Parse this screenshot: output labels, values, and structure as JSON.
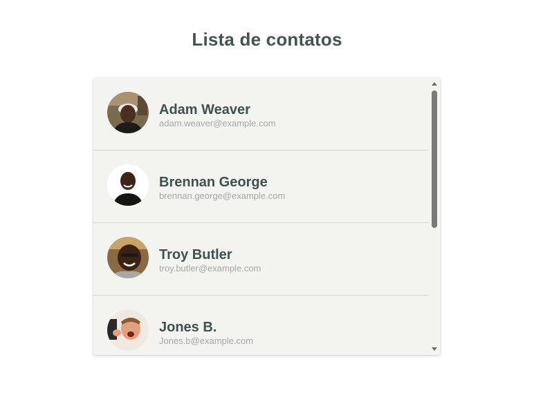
{
  "page": {
    "title": "Lista de contatos"
  },
  "contacts": [
    {
      "name": "Adam Weaver",
      "email": "adam.weaver@example.com",
      "avatar": "avatar-photo"
    },
    {
      "name": "Brennan George",
      "email": "brennan.george@example.com",
      "avatar": "avatar-photo"
    },
    {
      "name": "Troy Butler",
      "email": "troy.butler@example.com",
      "avatar": "avatar-photo"
    },
    {
      "name": "Jones B.",
      "email": "Jones.b@example.com",
      "avatar": "avatar-photo"
    }
  ],
  "colors": {
    "title": "#3f5453",
    "name": "#3d5150",
    "email": "#a4a9a8",
    "panel_bg": "#f3f3f0",
    "divider": "#d6d6d2",
    "scroll_thumb": "#7a7a7a"
  }
}
